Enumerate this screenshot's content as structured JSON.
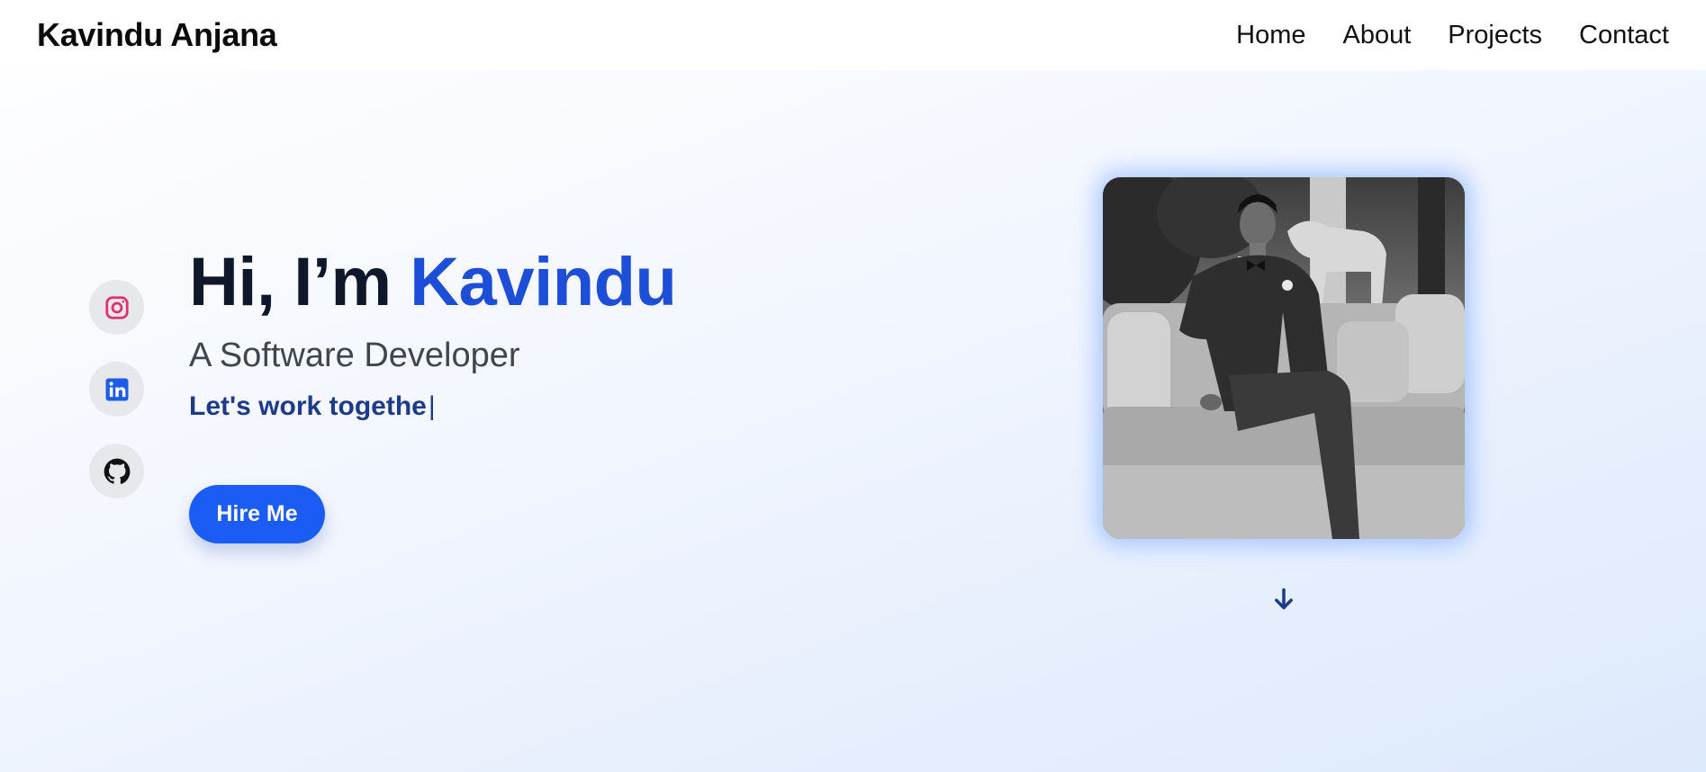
{
  "header": {
    "brand": "Kavindu Anjana",
    "nav": [
      {
        "label": "Home"
      },
      {
        "label": "About"
      },
      {
        "label": "Projects"
      },
      {
        "label": "Contact"
      }
    ]
  },
  "socials": [
    {
      "icon": "instagram-icon",
      "color": "#e1306c"
    },
    {
      "icon": "linkedin-icon",
      "color": "#1d5ce6"
    },
    {
      "icon": "github-icon",
      "color": "#111111"
    }
  ],
  "hero": {
    "greeting": "Hi, I’m",
    "name": "Kavindu",
    "subtitle": "A Software Developer",
    "typing_text": "Let's work togethe",
    "cursor": "|",
    "cta_label": "Hire Me"
  },
  "photo": {
    "style": "black-and-white portrait of a man in a suit seated on a sofa"
  },
  "scroll": {
    "icon": "arrow-down-icon"
  },
  "colors": {
    "accent": "#1d4ed8",
    "button": "#1b5cf5",
    "typing_text": "#1e3a8a"
  }
}
